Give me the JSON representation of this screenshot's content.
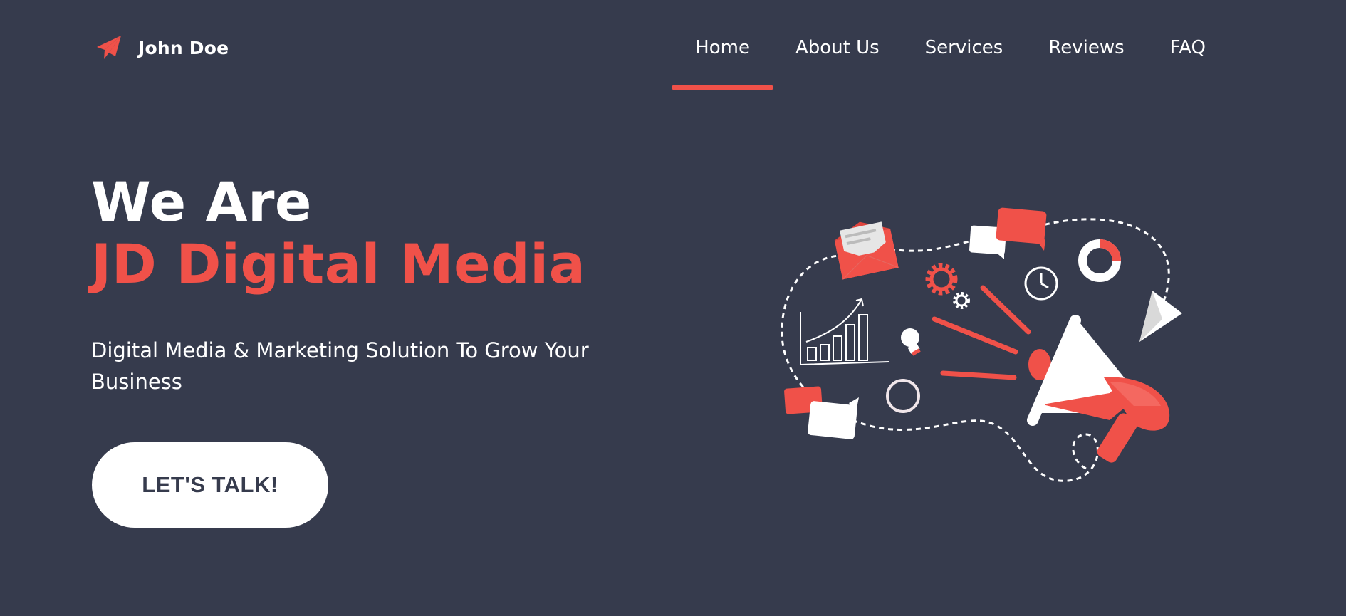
{
  "header": {
    "brand_name": "John Doe",
    "brand_icon": "paper-plane-icon",
    "nav": [
      {
        "label": "Home",
        "active": true
      },
      {
        "label": "About Us",
        "active": false
      },
      {
        "label": "Services",
        "active": false
      },
      {
        "label": "Reviews",
        "active": false
      },
      {
        "label": "FAQ",
        "active": false
      }
    ]
  },
  "hero": {
    "line1": "We Are",
    "line2": "JD Digital Media",
    "subtitle": "Digital Media & Marketing Solution To Grow Your Business",
    "cta_label": "LET'S TALK!"
  },
  "illustration": {
    "name": "digital-marketing-megaphone-illustration",
    "icons": [
      "megaphone-icon",
      "envelope-icon",
      "chat-bubble-icon",
      "gear-icon",
      "clock-icon",
      "donut-chart-icon",
      "paper-plane-icon",
      "bar-chart-icon",
      "lightbulb-icon"
    ]
  },
  "colors": {
    "background": "#363b4d",
    "accent": "#f05149",
    "text": "#ffffff"
  }
}
